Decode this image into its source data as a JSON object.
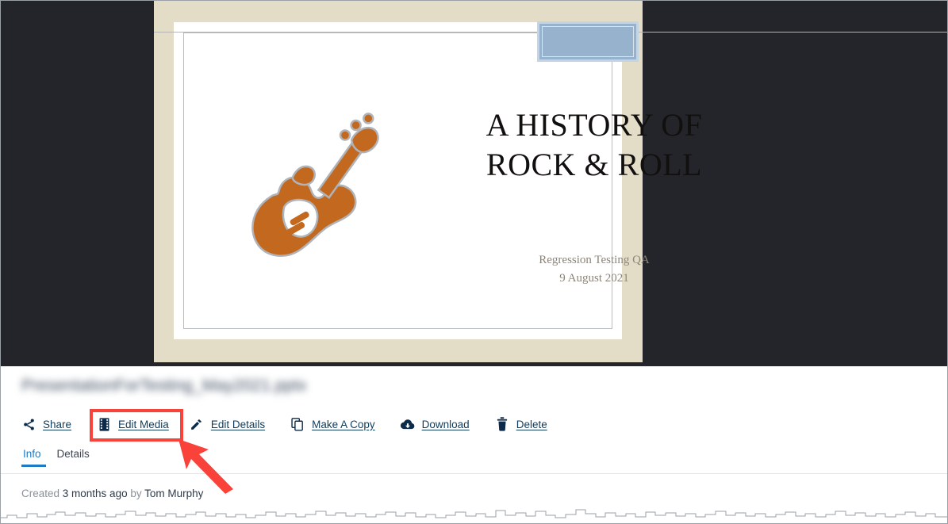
{
  "preview": {
    "slide": {
      "title_line1": "A HISTORY OF",
      "title_line2": "ROCK & ROLL",
      "subtitle_line1": "Regression Testing QA",
      "subtitle_line2": "9 August 2021",
      "graphic": "electric-guitar-icon",
      "graphic_color": "#c2691f",
      "stage_color": "#e3ddc8",
      "canvas_color": "#ffffff",
      "backdrop_color": "#24252a"
    },
    "selection_overlay": {
      "name": "blue-selection-rectangle",
      "fill": "#97b2cd",
      "border": "#c3d4e4"
    }
  },
  "details": {
    "file_name": "PresentationForTesting_May2021.pptx",
    "actions": [
      {
        "id": "share",
        "label": "Share",
        "icon": "share-icon"
      },
      {
        "id": "edit-media",
        "label": "Edit Media",
        "icon": "film-strip-icon"
      },
      {
        "id": "edit-details",
        "label": "Edit Details",
        "icon": "pencil-icon"
      },
      {
        "id": "make-a-copy",
        "label": "Make A Copy",
        "icon": "copy-icon"
      },
      {
        "id": "download",
        "label": "Download",
        "icon": "cloud-download-icon"
      },
      {
        "id": "delete",
        "label": "Delete",
        "icon": "trash-icon"
      }
    ],
    "tabs": [
      {
        "id": "info",
        "label": "Info",
        "active": true
      },
      {
        "id": "details",
        "label": "Details",
        "active": false
      }
    ],
    "meta": {
      "created_prefix": "Created ",
      "created_when": "3 months ago",
      "by_word": " by ",
      "author": "Tom Murphy"
    }
  },
  "annotations": {
    "highlight_target": "edit-media",
    "highlight_color": "#f9423a",
    "arrow_color": "#f9423a"
  },
  "colors": {
    "link": "#103d5d",
    "icon": "#0c2b4a",
    "accent_tab": "#1e7ac4",
    "muted_text": "#8b9199"
  }
}
